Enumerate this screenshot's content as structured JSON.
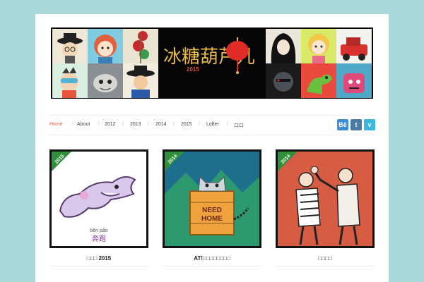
{
  "colors": {
    "background": "#a8d8da",
    "accent": "#e8553c",
    "ribbon": "#2f8f3a"
  },
  "banner": {
    "logo_text": "冰糖葫芦儿",
    "logo_year": "2015"
  },
  "nav": {
    "items": [
      {
        "label": "Home",
        "active": true
      },
      {
        "label": "About"
      },
      {
        "label": "2012"
      },
      {
        "label": "2013"
      },
      {
        "label": "2014"
      },
      {
        "label": "2015"
      },
      {
        "label": "Lofter"
      },
      {
        "label": "口口"
      }
    ],
    "separator": "/"
  },
  "social": {
    "behance": {
      "label": "Bē",
      "icon": "behance-icon",
      "color": "#3b8ed6"
    },
    "tumblr": {
      "label": "t",
      "icon": "tumblr-icon",
      "color": "#4d7aa3"
    },
    "vimeo": {
      "label": "v",
      "icon": "vimeo-icon",
      "color": "#3ab8e0"
    }
  },
  "posts": [
    {
      "ribbon": "2015",
      "title": "□□□ 2015",
      "caption_pinyin": "bēn  pǎo",
      "caption_hanzi": "奔跑"
    },
    {
      "ribbon": "2014",
      "title": "AT!□□□□□□□□",
      "sign_text_1": "NEED",
      "sign_text_2": "HOME"
    },
    {
      "ribbon": "2014",
      "title": "□□□□"
    }
  ]
}
